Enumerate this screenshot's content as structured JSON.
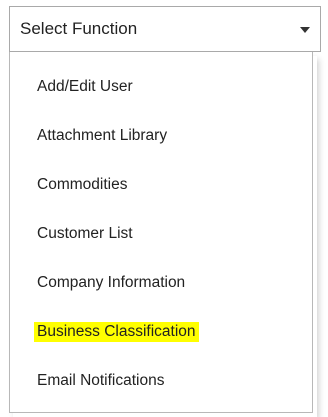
{
  "select": {
    "selected_label": "Select Function",
    "caret_icon": "chevron-down-icon"
  },
  "menu": {
    "items": [
      {
        "label": "Add/Edit User",
        "highlighted": false
      },
      {
        "label": "Attachment Library",
        "highlighted": false
      },
      {
        "label": "Commodities",
        "highlighted": false
      },
      {
        "label": "Customer List",
        "highlighted": false
      },
      {
        "label": "Company Information",
        "highlighted": false
      },
      {
        "label": "Business Classification",
        "highlighted": true
      },
      {
        "label": "Email Notifications",
        "highlighted": false
      }
    ],
    "highlight_color": "#ffff00"
  }
}
